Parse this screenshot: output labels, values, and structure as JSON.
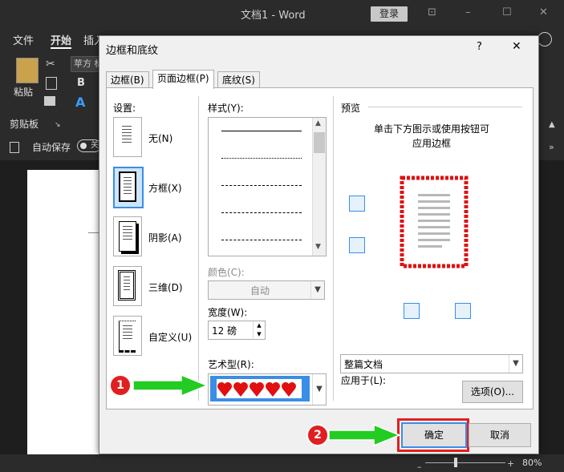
{
  "window": {
    "title": "文档1 - Word",
    "login_label": "登录",
    "controls": [
      "⊡",
      "–",
      "☐",
      "✕"
    ]
  },
  "ribbon": {
    "tabs": [
      "文件",
      "开始",
      "插入"
    ],
    "paste_label": "粘贴",
    "clipboard_label": "剪贴板",
    "font_name": "苹方 标",
    "bold": "B",
    "autosave_label": "自动保存",
    "autosave_state": "关"
  },
  "statusbar": {
    "zoom": "80%"
  },
  "dialog": {
    "title": "边框和底纹",
    "help": "?",
    "close": "✕",
    "tabs": [
      "边框(B)",
      "页面边框(P)",
      "底纹(S)"
    ],
    "active_tab": 1,
    "settings_label": "设置:",
    "settings": [
      {
        "label": "无(N)",
        "selected": false
      },
      {
        "label": "方框(X)",
        "selected": true
      },
      {
        "label": "阴影(A)",
        "selected": false
      },
      {
        "label": "三维(D)",
        "selected": false
      },
      {
        "label": "自定义(U)",
        "selected": false
      }
    ],
    "style_label": "样式(Y):",
    "color_label": "颜色(C):",
    "color_value": "自动",
    "width_label": "宽度(W):",
    "width_value": "12 磅",
    "art_label": "艺术型(R):",
    "preview_label": "预览",
    "preview_hint_1": "单击下方图示或使用按钮可",
    "preview_hint_2": "应用边框",
    "apply_to_label": "应用于(L):",
    "apply_to_value": "整篇文档",
    "options_button": "选项(O)...",
    "ok_button": "确定",
    "cancel_button": "取消"
  },
  "annotations": {
    "step1": "1",
    "step2": "2"
  },
  "colors": {
    "callout_red": "#e02020",
    "arrow_green": "#22cc22",
    "heart_red": "#e01010",
    "selection_blue": "#3a8ee6"
  }
}
